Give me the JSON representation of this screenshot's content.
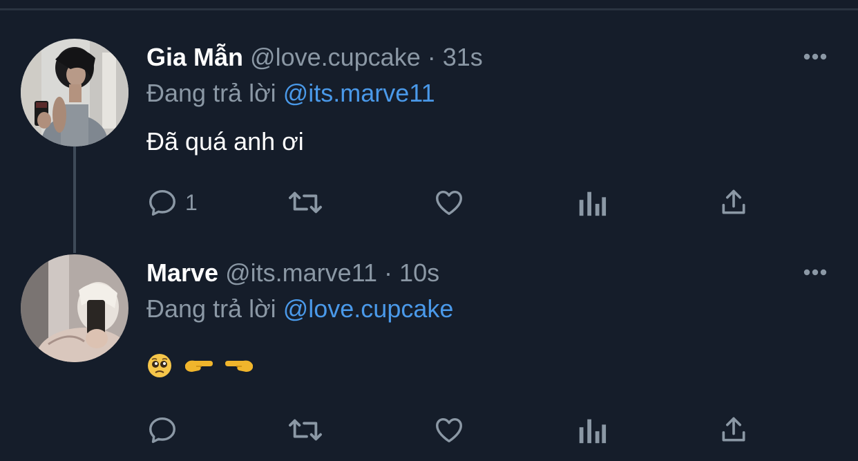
{
  "tweets": [
    {
      "display_name": "Gia Mẫn",
      "handle": "@love.cupcake",
      "separator": "·",
      "time": "31s",
      "reply_prefix": "Đang trả lời",
      "reply_to": "@its.marve11",
      "text": "Đã quá anh ơi",
      "reply_count": "1",
      "icons": [
        "reply-icon",
        "retweet-icon",
        "like-icon",
        "views-icon",
        "share-icon",
        "more-icon"
      ]
    },
    {
      "display_name": "Marve",
      "handle": "@its.marve11",
      "separator": "·",
      "time": "10s",
      "reply_prefix": "Đang trả lời",
      "reply_to": "@love.cupcake",
      "emojis": [
        "pleading-face-emoji",
        "pointing-right-emoji",
        "pointing-left-emoji"
      ],
      "icons": [
        "reply-icon",
        "retweet-icon",
        "like-icon",
        "views-icon",
        "share-icon",
        "more-icon"
      ]
    }
  ],
  "colors": {
    "background": "#151d2a",
    "text_primary": "#ffffff",
    "text_secondary": "#8b98a5",
    "mention": "#4a99e9",
    "icon": "#8b98a5",
    "thread_line": "#3e4a58"
  }
}
